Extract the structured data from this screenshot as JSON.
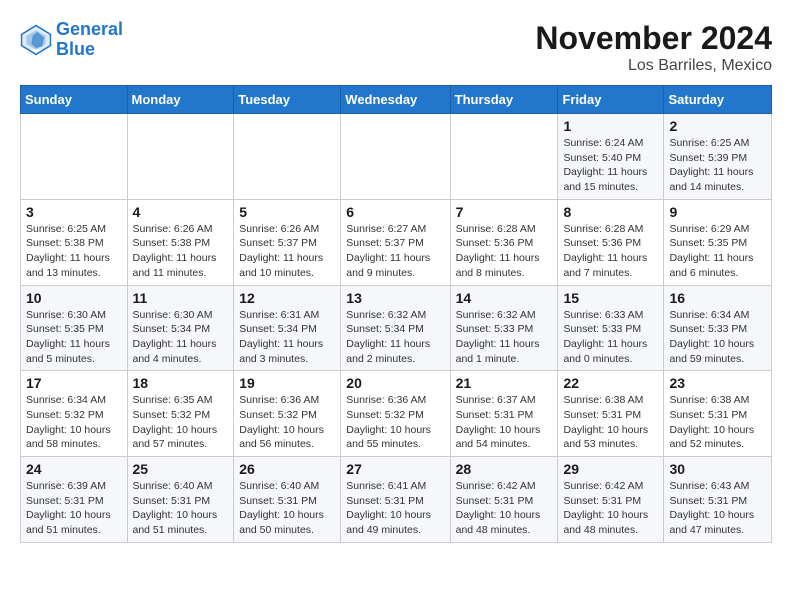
{
  "header": {
    "logo_line1": "General",
    "logo_line2": "Blue",
    "month_title": "November 2024",
    "location": "Los Barriles, Mexico"
  },
  "days_of_week": [
    "Sunday",
    "Monday",
    "Tuesday",
    "Wednesday",
    "Thursday",
    "Friday",
    "Saturday"
  ],
  "weeks": [
    [
      {
        "day": "",
        "info": ""
      },
      {
        "day": "",
        "info": ""
      },
      {
        "day": "",
        "info": ""
      },
      {
        "day": "",
        "info": ""
      },
      {
        "day": "",
        "info": ""
      },
      {
        "day": "1",
        "info": "Sunrise: 6:24 AM\nSunset: 5:40 PM\nDaylight: 11 hours and 15 minutes."
      },
      {
        "day": "2",
        "info": "Sunrise: 6:25 AM\nSunset: 5:39 PM\nDaylight: 11 hours and 14 minutes."
      }
    ],
    [
      {
        "day": "3",
        "info": "Sunrise: 6:25 AM\nSunset: 5:38 PM\nDaylight: 11 hours and 13 minutes."
      },
      {
        "day": "4",
        "info": "Sunrise: 6:26 AM\nSunset: 5:38 PM\nDaylight: 11 hours and 11 minutes."
      },
      {
        "day": "5",
        "info": "Sunrise: 6:26 AM\nSunset: 5:37 PM\nDaylight: 11 hours and 10 minutes."
      },
      {
        "day": "6",
        "info": "Sunrise: 6:27 AM\nSunset: 5:37 PM\nDaylight: 11 hours and 9 minutes."
      },
      {
        "day": "7",
        "info": "Sunrise: 6:28 AM\nSunset: 5:36 PM\nDaylight: 11 hours and 8 minutes."
      },
      {
        "day": "8",
        "info": "Sunrise: 6:28 AM\nSunset: 5:36 PM\nDaylight: 11 hours and 7 minutes."
      },
      {
        "day": "9",
        "info": "Sunrise: 6:29 AM\nSunset: 5:35 PM\nDaylight: 11 hours and 6 minutes."
      }
    ],
    [
      {
        "day": "10",
        "info": "Sunrise: 6:30 AM\nSunset: 5:35 PM\nDaylight: 11 hours and 5 minutes."
      },
      {
        "day": "11",
        "info": "Sunrise: 6:30 AM\nSunset: 5:34 PM\nDaylight: 11 hours and 4 minutes."
      },
      {
        "day": "12",
        "info": "Sunrise: 6:31 AM\nSunset: 5:34 PM\nDaylight: 11 hours and 3 minutes."
      },
      {
        "day": "13",
        "info": "Sunrise: 6:32 AM\nSunset: 5:34 PM\nDaylight: 11 hours and 2 minutes."
      },
      {
        "day": "14",
        "info": "Sunrise: 6:32 AM\nSunset: 5:33 PM\nDaylight: 11 hours and 1 minute."
      },
      {
        "day": "15",
        "info": "Sunrise: 6:33 AM\nSunset: 5:33 PM\nDaylight: 11 hours and 0 minutes."
      },
      {
        "day": "16",
        "info": "Sunrise: 6:34 AM\nSunset: 5:33 PM\nDaylight: 10 hours and 59 minutes."
      }
    ],
    [
      {
        "day": "17",
        "info": "Sunrise: 6:34 AM\nSunset: 5:32 PM\nDaylight: 10 hours and 58 minutes."
      },
      {
        "day": "18",
        "info": "Sunrise: 6:35 AM\nSunset: 5:32 PM\nDaylight: 10 hours and 57 minutes."
      },
      {
        "day": "19",
        "info": "Sunrise: 6:36 AM\nSunset: 5:32 PM\nDaylight: 10 hours and 56 minutes."
      },
      {
        "day": "20",
        "info": "Sunrise: 6:36 AM\nSunset: 5:32 PM\nDaylight: 10 hours and 55 minutes."
      },
      {
        "day": "21",
        "info": "Sunrise: 6:37 AM\nSunset: 5:31 PM\nDaylight: 10 hours and 54 minutes."
      },
      {
        "day": "22",
        "info": "Sunrise: 6:38 AM\nSunset: 5:31 PM\nDaylight: 10 hours and 53 minutes."
      },
      {
        "day": "23",
        "info": "Sunrise: 6:38 AM\nSunset: 5:31 PM\nDaylight: 10 hours and 52 minutes."
      }
    ],
    [
      {
        "day": "24",
        "info": "Sunrise: 6:39 AM\nSunset: 5:31 PM\nDaylight: 10 hours and 51 minutes."
      },
      {
        "day": "25",
        "info": "Sunrise: 6:40 AM\nSunset: 5:31 PM\nDaylight: 10 hours and 51 minutes."
      },
      {
        "day": "26",
        "info": "Sunrise: 6:40 AM\nSunset: 5:31 PM\nDaylight: 10 hours and 50 minutes."
      },
      {
        "day": "27",
        "info": "Sunrise: 6:41 AM\nSunset: 5:31 PM\nDaylight: 10 hours and 49 minutes."
      },
      {
        "day": "28",
        "info": "Sunrise: 6:42 AM\nSunset: 5:31 PM\nDaylight: 10 hours and 48 minutes."
      },
      {
        "day": "29",
        "info": "Sunrise: 6:42 AM\nSunset: 5:31 PM\nDaylight: 10 hours and 48 minutes."
      },
      {
        "day": "30",
        "info": "Sunrise: 6:43 AM\nSunset: 5:31 PM\nDaylight: 10 hours and 47 minutes."
      }
    ]
  ]
}
